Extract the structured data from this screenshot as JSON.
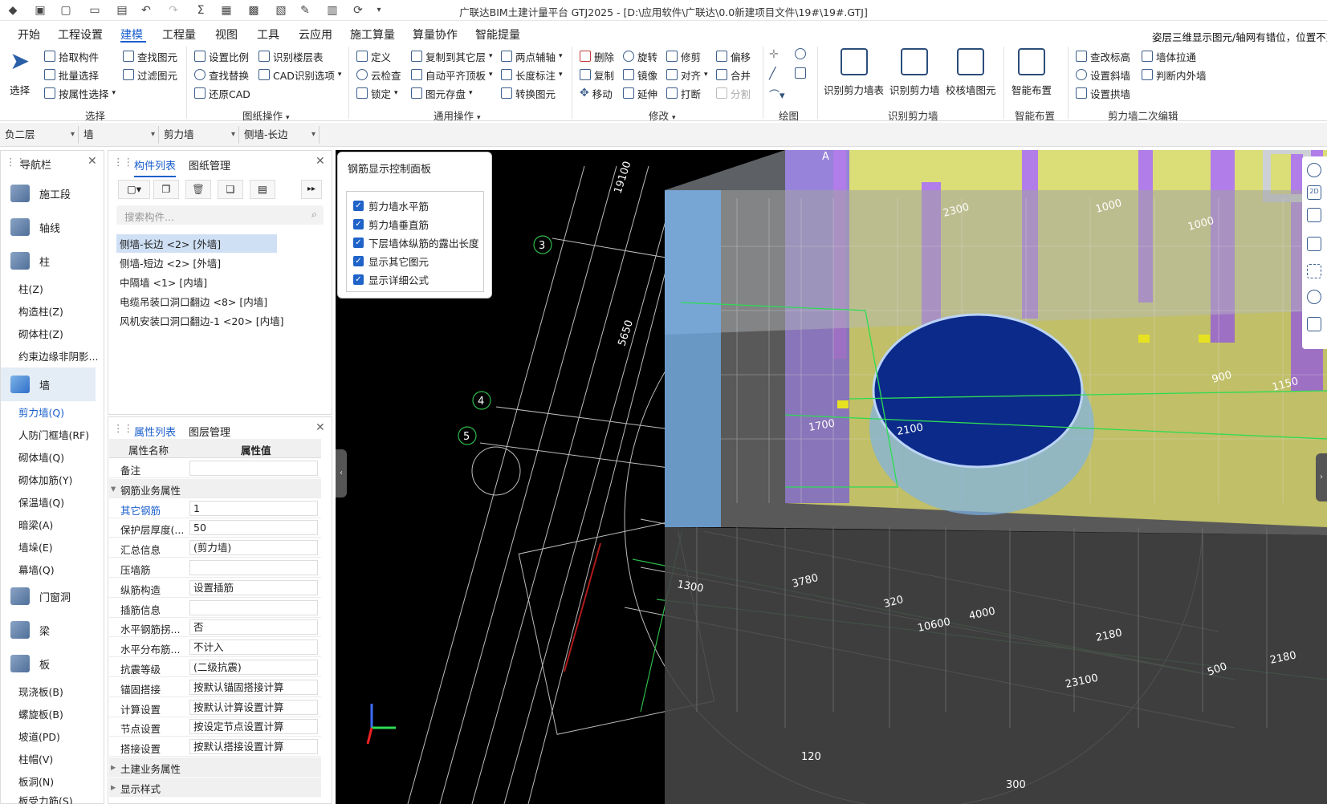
{
  "window": {
    "title": "广联达BIM土建计量平台 GTJ2025 - [D:\\应用软件\\广联达\\0.0新建项目文件\\19#\\19#.GTJ]"
  },
  "menu": {
    "items": [
      "开始",
      "工程设置",
      "建模",
      "工程量",
      "视图",
      "工具",
      "云应用",
      "施工算量",
      "算量协作",
      "智能提量"
    ],
    "active": "建模"
  },
  "notice": "姿层三维显示图元/轴网有错位，位置不对",
  "ribbon": {
    "select": {
      "big": "选择",
      "items": [
        "拾取构件",
        "批量选择",
        "按属性选择",
        "查找图元",
        "过滤图元"
      ],
      "group": "选择"
    },
    "drawing": {
      "items": [
        "设置比例",
        "识别楼层表",
        "查找替换",
        "CAD识别选项",
        "还原CAD"
      ],
      "group": "图纸操作"
    },
    "common": {
      "items": [
        "定义",
        "复制到其它层",
        "两点辅轴",
        "云检查",
        "自动平齐顶板",
        "长度标注",
        "锁定",
        "图元存盘",
        "转换图元"
      ],
      "group": "通用操作"
    },
    "modify": {
      "items": [
        "删除",
        "旋转",
        "修剪",
        "偏移",
        "复制",
        "镜像",
        "对齐",
        "合并",
        "移动",
        "延伸",
        "打断",
        "分割"
      ],
      "group": "修改"
    },
    "draw": {
      "group": "绘图"
    },
    "recog": {
      "items": [
        "识别剪力墙表",
        "识别剪力墙",
        "校核墙图元"
      ],
      "group": "识别剪力墙"
    },
    "smart": {
      "big": "智能布置",
      "group": "智能布置"
    },
    "secondary": {
      "items": [
        "查改标高",
        "墙体拉通",
        "设置斜墙",
        "判断内外墙",
        "设置拱墙"
      ],
      "group": "剪力墙二次编辑"
    }
  },
  "dropdowns": [
    "负二层",
    "墙",
    "剪力墙",
    "侧墙-长边"
  ],
  "nav": {
    "title": "导航栏",
    "groups": [
      {
        "label": "施工段"
      },
      {
        "label": "轴线"
      },
      {
        "label": "柱"
      }
    ],
    "col_items": [
      "柱(Z)",
      "构造柱(Z)",
      "砌体柱(Z)",
      "约束边缘非阴影..."
    ],
    "wall_label": "墙",
    "wall_items": [
      "剪力墙(Q)",
      "人防门框墙(RF)",
      "砌体墙(Q)",
      "砌体加筋(Y)",
      "保温墙(Q)",
      "暗梁(A)",
      "墙垛(E)",
      "幕墙(Q)"
    ],
    "more_groups": [
      "门窗洞",
      "梁",
      "板"
    ],
    "slab_items": [
      "现浇板(B)",
      "螺旋板(B)",
      "坡道(PD)",
      "柱帽(V)",
      "板洞(N)",
      "板受力筋(S)"
    ]
  },
  "components": {
    "tabs": [
      "构件列表",
      "图纸管理"
    ],
    "search_placeholder": "搜索构件...",
    "items": [
      "侧墙-长边 <2> [外墙]",
      "侧墙-短边 <2> [外墙]",
      "中隔墙 <1> [内墙]",
      "电缆吊装口洞口翻边 <8> [内墙]",
      "风机安装口洞口翻边-1 <20> [内墙]"
    ]
  },
  "properties": {
    "tabs": [
      "属性列表",
      "图层管理"
    ],
    "headers": [
      "属性名称",
      "属性值"
    ],
    "rows": [
      {
        "name": "备注",
        "value": ""
      },
      {
        "name": "钢筋业务属性",
        "value": null,
        "group": true
      },
      {
        "name": "其它钢筋",
        "value": "1",
        "blue": true
      },
      {
        "name": "保护层厚度(...",
        "value": "50"
      },
      {
        "name": "汇总信息",
        "value": "(剪力墙)"
      },
      {
        "name": "压墙筋",
        "value": ""
      },
      {
        "name": "纵筋构造",
        "value": "设置插筋"
      },
      {
        "name": "插筋信息",
        "value": ""
      },
      {
        "name": "水平钢筋拐...",
        "value": "否"
      },
      {
        "name": "水平分布筋...",
        "value": "不计入"
      },
      {
        "name": "抗震等级",
        "value": "(二级抗震)"
      },
      {
        "name": "锚固搭接",
        "value": "按默认锚固搭接计算"
      },
      {
        "name": "计算设置",
        "value": "按默认计算设置计算"
      },
      {
        "name": "节点设置",
        "value": "按设定节点设置计算"
      },
      {
        "name": "搭接设置",
        "value": "按默认搭接设置计算"
      },
      {
        "name": "土建业务属性",
        "value": null,
        "group": true
      },
      {
        "name": "显示样式",
        "value": null,
        "group": true
      }
    ]
  },
  "rebar_panel": {
    "title": "钢筋显示控制面板",
    "options": [
      "剪力墙水平筋",
      "剪力墙垂直筋",
      "下层墙体纵筋的露出长度",
      "显示其它图元",
      "显示详细公式"
    ]
  },
  "viewport_labels": {
    "dims": [
      "19100",
      "5650",
      "3",
      "4",
      "5",
      "1300",
      "3780",
      "320",
      "4000",
      "10600",
      "2180",
      "23100",
      "500",
      "2180",
      "120",
      "300",
      "2300",
      "1000",
      "1000",
      "900",
      "1150",
      "1700",
      "2100",
      "A"
    ]
  },
  "colors": {
    "accent": "#1a5fcc",
    "wall_blue": "#7db3e8",
    "yellow": "#e6e221",
    "purple": "#8a2be2"
  }
}
